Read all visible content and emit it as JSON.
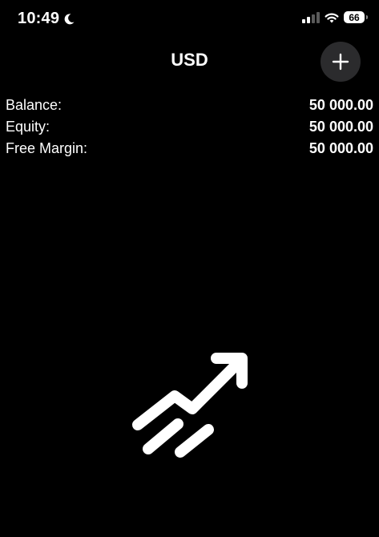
{
  "status_bar": {
    "time": "10:49",
    "battery": "66",
    "icons": [
      "moon-icon",
      "cellular-signal-icon",
      "wifi-icon",
      "battery-icon"
    ]
  },
  "header": {
    "title": "USD",
    "add_button_icon": "plus-icon"
  },
  "account": {
    "rows": [
      {
        "label": "Balance:",
        "value": "50 000.00"
      },
      {
        "label": "Equity:",
        "value": "50 000.00"
      },
      {
        "label": "Free Margin:",
        "value": "50 000.00"
      }
    ]
  },
  "illustration": {
    "icon": "trending-up-arrow-icon"
  },
  "colors": {
    "background": "#000000",
    "text": "#ffffff",
    "button_background": "#2b2b2d"
  }
}
